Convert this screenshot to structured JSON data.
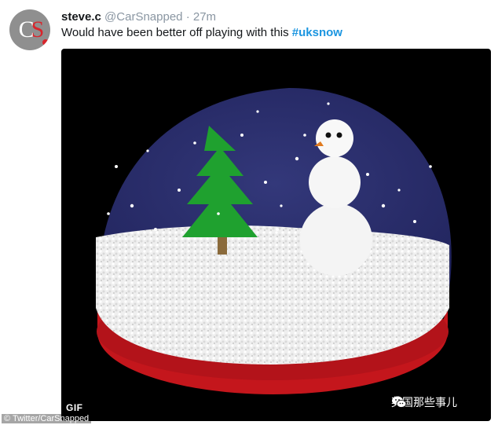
{
  "tweet": {
    "avatar": {
      "letters_left": "C",
      "letters_right": "S"
    },
    "display_name": "steve.c",
    "handle": "@CarSnapped",
    "separator": "·",
    "timestamp": "27m",
    "text": "Would have been better off playing with this ",
    "hashtag": "#uksnow"
  },
  "media": {
    "gif_label": "GIF",
    "watermark_text": "英国那些事儿",
    "credit": "© Twitter/CarSnapped",
    "icon": "wechat-icon",
    "colors": {
      "background": "#000000",
      "globe": "#2b2f6c",
      "snow": "#f2f2f2",
      "base": "#c4161c",
      "tree": "#1fa12f",
      "trunk": "#8a6a3b"
    }
  },
  "colors": {
    "hashtag": "#1b95e0",
    "name": "#14171a",
    "muted": "#8a96a2"
  }
}
